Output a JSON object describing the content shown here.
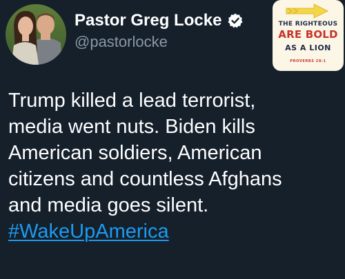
{
  "author": {
    "display_name": "Pastor Greg Locke",
    "handle": "@pastorlocke",
    "verified": true,
    "avatar_icon": "profile-photo-couple"
  },
  "badge": {
    "line1": "THE RIGHTEOUS",
    "line2": "ARE BOLD",
    "line3": "AS A LION",
    "line4": "PROVERBS 28:1"
  },
  "tweet": {
    "lines": [
      "Trump killed a lead terrorist,",
      "media went nuts. Biden kills",
      "American soldiers, American",
      "citizens and countless Afghans",
      "and media goes silent."
    ],
    "hashtag": "#WakeUpAmerica"
  },
  "colors": {
    "background": "#15202b",
    "text": "#ffffff",
    "secondary_text": "#8b98a5",
    "link": "#1d9bf0",
    "verified": "#ffffff"
  }
}
